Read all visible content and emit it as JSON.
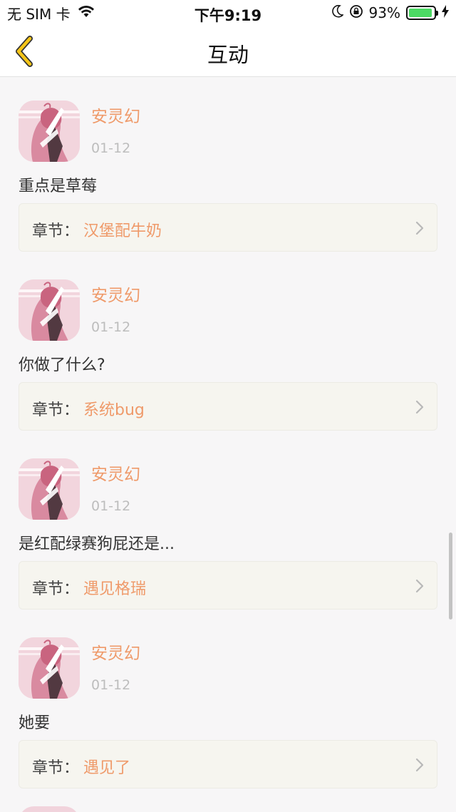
{
  "status_bar": {
    "carrier": "无 SIM 卡",
    "time": "下午9:19",
    "battery_percent": "93%",
    "battery_level": 0.93,
    "icons": [
      "wifi-icon",
      "moon-icon",
      "orientation-lock-icon",
      "battery-icon",
      "charging-icon"
    ]
  },
  "nav": {
    "title": "互动",
    "back_icon": "chevron-left-icon",
    "back_color": "#f5c518"
  },
  "colors": {
    "accent": "#ef9a6a",
    "chapter_bg": "#f6f5ef"
  },
  "chapter_prefix": "章节：",
  "items": [
    {
      "user": "安灵幻",
      "date": "01-12",
      "content": "重点是草莓",
      "chapter": "汉堡配牛奶"
    },
    {
      "user": "安灵幻",
      "date": "01-12",
      "content": "你做了什么?",
      "chapter": "系统bug"
    },
    {
      "user": "安灵幻",
      "date": "01-12",
      "content": "是红配绿赛狗屁还是...",
      "chapter": "遇见格瑞"
    },
    {
      "user": "安灵幻",
      "date": "01-12",
      "content": "她要",
      "chapter": "遇见了"
    }
  ]
}
